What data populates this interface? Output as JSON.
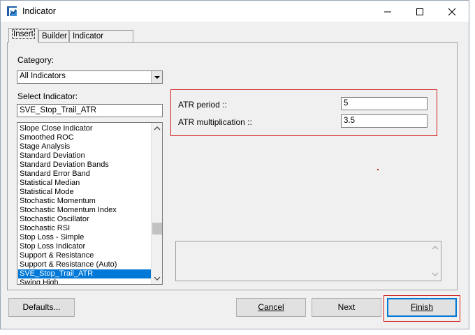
{
  "window": {
    "title": "Indicator",
    "controls": [
      "minimize-icon",
      "maximize-icon",
      "close-icon"
    ]
  },
  "tabs": [
    "Insert",
    "Builder",
    "Indicator Toolbar"
  ],
  "insert_tab": {
    "category_label": "Category:",
    "category_value": "All Indicators",
    "select_indicator_label": "Select Indicator:",
    "select_indicator_value": "SVE_Stop_Trail_ATR",
    "indicator_list": [
      "Slope Close Indicator",
      "Smoothed ROC",
      "Stage Analysis",
      "Standard Deviation",
      "Standard Deviation Bands",
      "Standard Error Band",
      "Statistical Median",
      "Statistical Mode",
      "Stochastic Momentum",
      "Stochastic Momentum  Index",
      "Stochastic Oscillator",
      "Stochastic RSI",
      "Stop Loss - Simple",
      "Stop Loss Indicator",
      "Support & Resistance",
      "Support & Resistance (Auto)",
      "SVE_Stop_Trail_ATR",
      "Swing High"
    ],
    "selected_index": 16
  },
  "parameters": [
    {
      "label": "ATR period ::",
      "value": "5"
    },
    {
      "label": "ATR multiplication ::",
      "value": "3.5"
    }
  ],
  "buttons": {
    "defaults": "Defaults...",
    "cancel": "Cancel",
    "next": "Next",
    "finish": "Finish"
  },
  "colors": {
    "accent": "#0078d7",
    "highlight_red": "#d11a1a",
    "window_bg": "#f0f0f0"
  }
}
